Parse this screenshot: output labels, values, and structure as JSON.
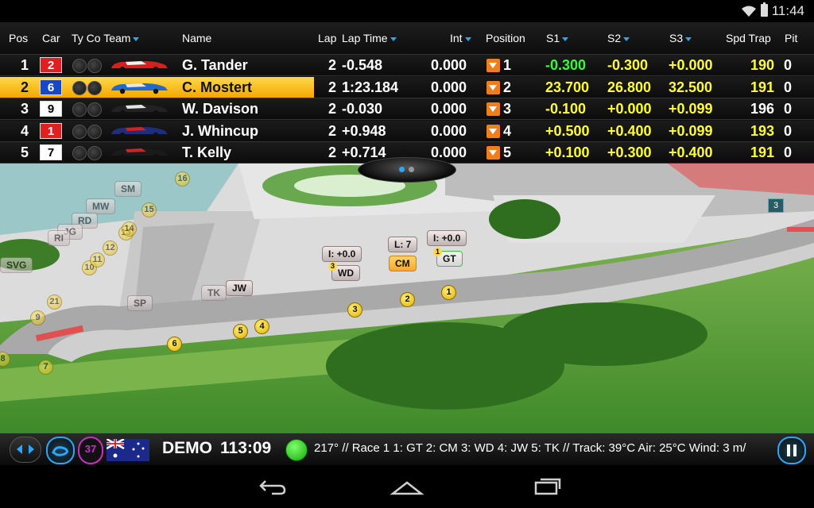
{
  "status": {
    "time": "11:44"
  },
  "columns": {
    "pos": "Pos",
    "car": "Car",
    "ty_co_team": "Ty Co Team",
    "name": "Name",
    "lap": "Lap",
    "lap_time": "Lap Time",
    "int": "Int",
    "position": "Position",
    "s1": "S1",
    "s2": "S2",
    "s3": "S3",
    "spd_trap": "Spd Trap",
    "pit": "Pit"
  },
  "drivers": [
    {
      "pos": "1",
      "car": "2",
      "car_bg": "#e02020",
      "car_fg": "#ffffff",
      "livery": "holden-red-white",
      "name": "G. Tander",
      "lap": "2",
      "time": "-0.548",
      "int": "0.000",
      "position": "1",
      "s1": "-0.300",
      "s1_color": "#33ff33",
      "s2": "-0.300",
      "s2_color": "#ffff33",
      "s3": "+0.000",
      "s3_color": "#ffff33",
      "spd": "190",
      "spd_color": "#ffff33",
      "pit": "0"
    },
    {
      "pos": "2",
      "car": "6",
      "car_bg": "#1548c8",
      "car_fg": "#ffffff",
      "livery": "ford-blue-white",
      "name": "C. Mostert",
      "lap": "2",
      "time": "1:23.184",
      "int": "0.000",
      "position": "2",
      "s1": "23.700",
      "s1_color": "#ffff33",
      "s2": "26.800",
      "s2_color": "#ffff33",
      "s3": "32.500",
      "s3_color": "#ffff33",
      "spd": "191",
      "spd_color": "#ffff33",
      "pit": "0"
    },
    {
      "pos": "3",
      "car": "9",
      "car_bg": "#ffffff",
      "car_fg": "#000000",
      "livery": "mercedes-black-white",
      "name": "W. Davison",
      "lap": "2",
      "time": "-0.030",
      "int": "0.000",
      "position": "3",
      "s1": "-0.100",
      "s1_color": "#ffff33",
      "s2": "+0.000",
      "s2_color": "#ffff33",
      "s3": "+0.099",
      "s3_color": "#ffff33",
      "spd": "196",
      "spd_color": "#ffffff",
      "pit": "0"
    },
    {
      "pos": "4",
      "car": "1",
      "car_bg": "#e02020",
      "car_fg": "#ffffff",
      "livery": "holden-redbull",
      "name": "J. Whincup",
      "lap": "2",
      "time": "+0.948",
      "int": "0.000",
      "position": "4",
      "s1": "+0.500",
      "s1_color": "#ffff33",
      "s2": "+0.400",
      "s2_color": "#ffff33",
      "s3": "+0.099",
      "s3_color": "#ffff33",
      "spd": "193",
      "spd_color": "#ffff33",
      "pit": "0"
    },
    {
      "pos": "5",
      "car": "7",
      "car_bg": "#ffffff",
      "car_fg": "#000000",
      "livery": "nissan-black-red",
      "name": "T. Kelly",
      "lap": "2",
      "time": "+0.714",
      "int": "0.000",
      "position": "5",
      "s1": "+0.100",
      "s1_color": "#ffff33",
      "s2": "+0.300",
      "s2_color": "#ffff33",
      "s3": "+0.400",
      "s3_color": "#ffff33",
      "spd": "191",
      "spd_color": "#ffff33",
      "pit": "0"
    }
  ],
  "map": {
    "car_tags": [
      {
        "label": "I: +0.0",
        "style": "normal"
      },
      {
        "label": "WD",
        "style": "normal",
        "rank": "3"
      },
      {
        "label": "L: 7",
        "style": "normal"
      },
      {
        "label": "CM",
        "style": "cm"
      },
      {
        "label": "I: +0.0",
        "style": "normal"
      },
      {
        "label": "GT",
        "style": "gt",
        "rank": "1"
      },
      {
        "label": "JW",
        "style": "normal"
      },
      {
        "label": "TK",
        "style": "faded"
      },
      {
        "label": "SP",
        "style": "faded"
      },
      {
        "label": "SM",
        "style": "faded"
      },
      {
        "label": "MW",
        "style": "faded"
      },
      {
        "label": "RD",
        "style": "faded"
      },
      {
        "label": "JG",
        "style": "faded"
      },
      {
        "label": "RI",
        "style": "faded"
      },
      {
        "label": "SVG",
        "style": "faded"
      }
    ],
    "markers": [
      "1",
      "2",
      "3",
      "4",
      "5",
      "6",
      "7",
      "8",
      "9",
      "10",
      "11",
      "12",
      "13",
      "14",
      "15",
      "16",
      "21"
    ],
    "sector_badge": "3"
  },
  "control_bar": {
    "lap_count": "37",
    "session": "DEMO",
    "timer": "113:09",
    "ticker": "217°  //  Race 1 1: GT  2: CM  3: WD  4: JW  5: TK  //  Track: 39°C Air: 25°C Wind: 3 m/"
  }
}
